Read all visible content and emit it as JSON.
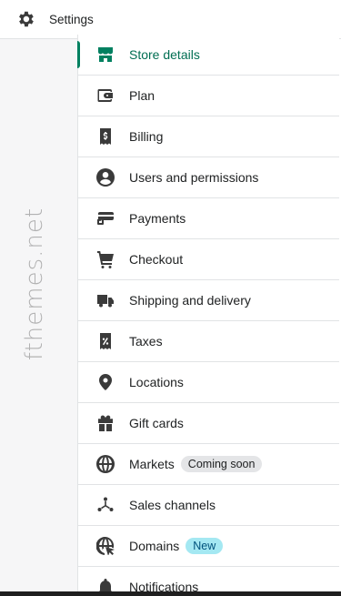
{
  "header": {
    "title": "Settings",
    "icon": "gear-icon"
  },
  "watermark": "fthemes.net",
  "colors": {
    "accent": "#008060",
    "new_badge_bg": "#a4e8f2",
    "coming_soon_bg": "#e4e5e7"
  },
  "menu": {
    "items": [
      {
        "label": "Store details",
        "icon": "store-icon",
        "active": true
      },
      {
        "label": "Plan",
        "icon": "wallet-icon"
      },
      {
        "label": "Billing",
        "icon": "receipt-dollar-icon"
      },
      {
        "label": "Users and permissions",
        "icon": "user-circle-icon"
      },
      {
        "label": "Payments",
        "icon": "credit-card-icon"
      },
      {
        "label": "Checkout",
        "icon": "cart-icon"
      },
      {
        "label": "Shipping and delivery",
        "icon": "truck-icon"
      },
      {
        "label": "Taxes",
        "icon": "receipt-percent-icon"
      },
      {
        "label": "Locations",
        "icon": "location-pin-icon"
      },
      {
        "label": "Gift cards",
        "icon": "gift-icon"
      },
      {
        "label": "Markets",
        "icon": "globe-icon",
        "badge": "Coming soon"
      },
      {
        "label": "Sales channels",
        "icon": "channels-icon"
      },
      {
        "label": "Domains",
        "icon": "globe-cursor-icon",
        "badge": "New"
      },
      {
        "label": "Notifications",
        "icon": "bell-icon"
      }
    ]
  }
}
